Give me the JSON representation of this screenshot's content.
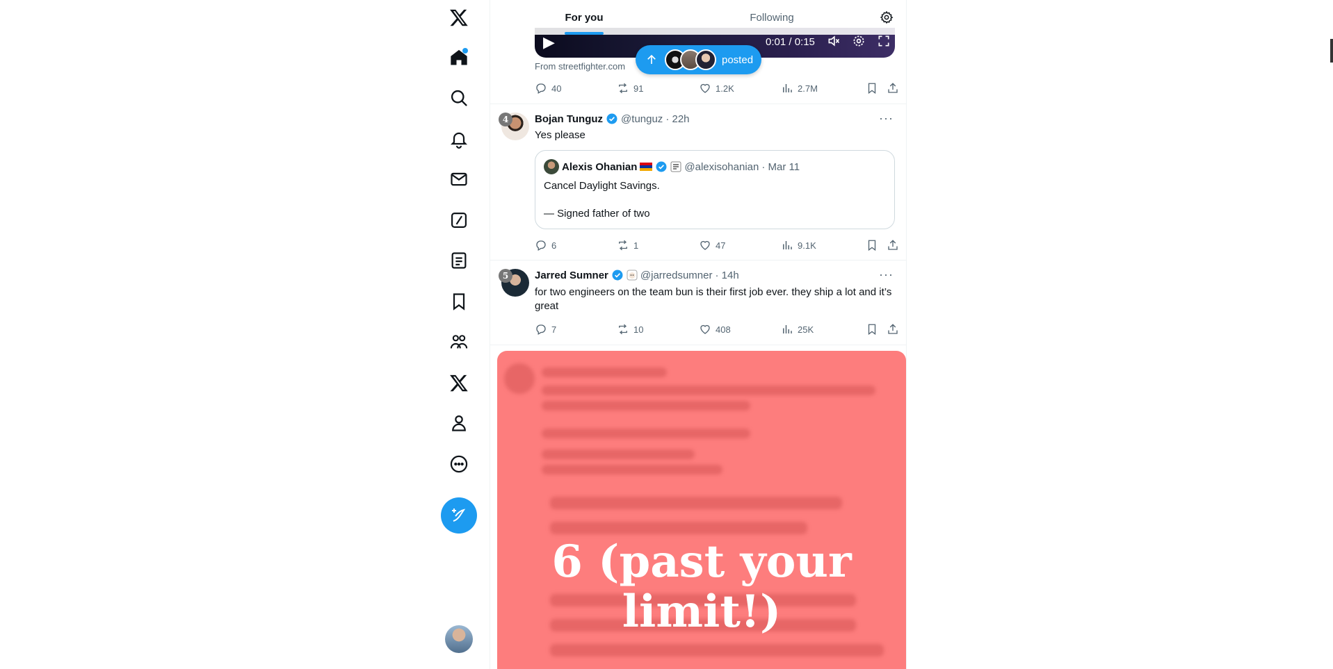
{
  "nav": {
    "items": [
      {
        "name": "x-logo",
        "has_dot": false
      },
      {
        "name": "home",
        "has_dot": true
      },
      {
        "name": "explore"
      },
      {
        "name": "notifications"
      },
      {
        "name": "messages"
      },
      {
        "name": "grok"
      },
      {
        "name": "lists"
      },
      {
        "name": "bookmarks"
      },
      {
        "name": "communities"
      },
      {
        "name": "premium"
      },
      {
        "name": "profile"
      },
      {
        "name": "more"
      }
    ],
    "accent": "#1d9bf0"
  },
  "tabs": {
    "for_you": "For you",
    "following": "Following",
    "active": "For you"
  },
  "video": {
    "time": "0:01 / 0:15",
    "source": "From streetfighter.com"
  },
  "posted_pill": {
    "label": "posted"
  },
  "tweets": [
    {
      "replies": "40",
      "reposts": "91",
      "likes": "1.2K",
      "views": "2.7M"
    },
    {
      "rank": "4",
      "name": "Bojan Tunguz",
      "handle": "@tunguz",
      "time": "· 22h",
      "text": "Yes please",
      "quote": {
        "name": "Alexis Ohanian",
        "handle": "@alexisohanian",
        "time": "· Mar 11",
        "line1": "Cancel Daylight Savings.",
        "line2": "— Signed father of two"
      },
      "replies": "6",
      "reposts": "1",
      "likes": "47",
      "views": "9.1K"
    },
    {
      "rank": "5",
      "name": "Jarred Sumner",
      "handle": "@jarredsumner",
      "time": "· 14h",
      "text": "for two engineers on the team bun is their first job ever. they ship a lot and it’s great",
      "replies": "7",
      "reposts": "10",
      "likes": "408",
      "views": "25K"
    }
  ],
  "limit_overlay": {
    "line1": "6 (past your",
    "line2": "limit!)",
    "color": "#fd7d7d"
  }
}
